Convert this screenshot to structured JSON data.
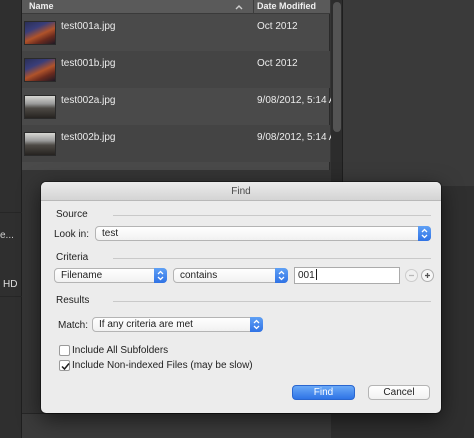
{
  "file_browser": {
    "columns": {
      "name": "Name",
      "date_modified": "Date Modified"
    },
    "rows": [
      {
        "name": "test001a.jpg",
        "date": "Oct 2012"
      },
      {
        "name": "test001b.jpg",
        "date": "Oct 2012"
      },
      {
        "name": "test002a.jpg",
        "date": "9/08/2012, 5:14 A"
      },
      {
        "name": "test002b.jpg",
        "date": "9/08/2012, 5:14 A"
      }
    ]
  },
  "left_panel": {
    "partial_label": "e...",
    "hd_label": "HD"
  },
  "dialog": {
    "title": "Find",
    "source": {
      "section_label": "Source",
      "look_in_label": "Look in:",
      "look_in_value": "test"
    },
    "criteria": {
      "section_label": "Criteria",
      "field_value": "Filename",
      "operator_value": "contains",
      "query_value": "001"
    },
    "results": {
      "section_label": "Results",
      "match_label": "Match:",
      "match_value": "If any criteria are met"
    },
    "options": [
      {
        "label": "Include All Subfolders",
        "checked": false
      },
      {
        "label": "Include Non-indexed Files (may be slow)",
        "checked": true
      }
    ],
    "buttons": {
      "find": "Find",
      "cancel": "Cancel"
    }
  },
  "colors": {
    "accent": "#2f74e6",
    "dialog_bg": "#ececec",
    "app_bg": "#353535"
  }
}
